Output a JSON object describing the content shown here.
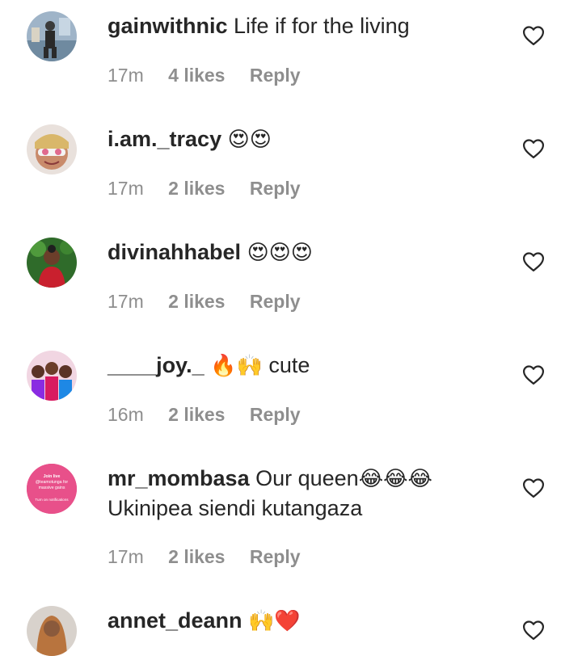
{
  "comments": [
    {
      "username": "gainwithnic",
      "text": "Life if for the living",
      "emoji": "",
      "text2": "",
      "time": "17m",
      "likes": "4 likes",
      "reply": "Reply"
    },
    {
      "username": "i.am._tracy",
      "text": "",
      "emoji": "😍😍",
      "text2": "",
      "time": "17m",
      "likes": "2 likes",
      "reply": "Reply"
    },
    {
      "username": "divinahhabel",
      "text": "",
      "emoji": "😍😍😍",
      "text2": "",
      "time": "17m",
      "likes": "2 likes",
      "reply": "Reply"
    },
    {
      "username": "____joy._",
      "text": "",
      "emoji": "🔥🙌",
      "text2": "cute",
      "time": "16m",
      "likes": "2 likes",
      "reply": "Reply"
    },
    {
      "username": "mr_mombasa",
      "text": "Our queen",
      "emoji": "😂😂😂",
      "line2": "Ukinipea siendi kutangaza",
      "time": "17m",
      "likes": "2 likes",
      "reply": "Reply",
      "avatar_text": [
        "Join live",
        "@teamotunga for",
        "massive gains",
        "Turn on notifications"
      ]
    },
    {
      "username": "annet_deann",
      "text": "",
      "emoji": "🙌❤️",
      "text2": ""
    }
  ],
  "colors": {
    "text": "#262626",
    "meta": "#8e8e8e",
    "background": "#ffffff",
    "avatar_promo": "#e8508a"
  },
  "icons": {
    "like": "heart-outline-icon"
  }
}
